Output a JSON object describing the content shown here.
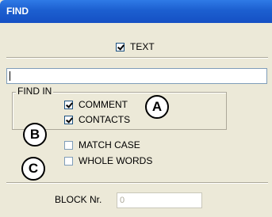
{
  "window": {
    "title": "FIND"
  },
  "top_option": {
    "label": "TEXT",
    "checked": true
  },
  "search": {
    "value": ""
  },
  "find_in": {
    "group_label": "FIND IN",
    "comment": {
      "label": "COMMENT",
      "checked": true
    },
    "contacts": {
      "label": "CONTACTS",
      "checked": true
    }
  },
  "options": {
    "match_case": {
      "label": "MATCH CASE",
      "checked": false
    },
    "whole_words": {
      "label": "WHOLE WORDS",
      "checked": false
    }
  },
  "block": {
    "label": "BLOCK Nr.",
    "value": "0"
  },
  "callouts": {
    "a": "A",
    "b": "B",
    "c": "C"
  }
}
